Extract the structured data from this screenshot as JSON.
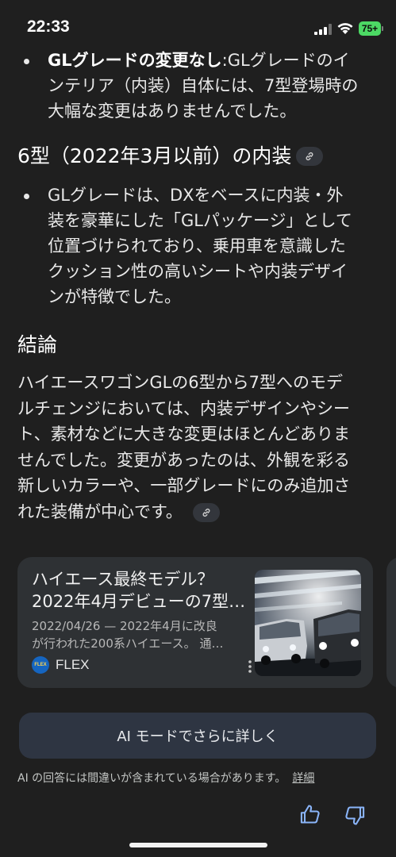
{
  "status_bar": {
    "time": "22:33",
    "battery": "75+",
    "battery_color": "#4cd964"
  },
  "content": {
    "bullet1": {
      "bold": "GLグレードの変更なし",
      "lines": [
        ":GLグレードのイ",
        "ンテリア（内装）自体には、7型登場時の",
        "大幅な変更はありませんでした。"
      ]
    },
    "heading1": "6型（2022年3月以前）の内装",
    "bullet2": {
      "lines": [
        "GLグレードは、DXをベースに内装・外",
        "装を豪華にした「GLパッケージ」として",
        "位置づけられており、乗用車を意識した",
        "クッション性の高いシートや内装デザイ",
        "ンが特徴でした。"
      ]
    },
    "heading2": "結論",
    "conclusion": {
      "lines": [
        "ハイエースワゴンGLの6型から7型へのモデ",
        "ルチェンジにおいては、内装デザインやシー",
        "ト、素材などに大きな変更はほとんどありま",
        "せんでした。変更があったのは、外観を彩る",
        "新しいカラーや、一部グレードにのみ追加さ",
        "れた装備が中心です。"
      ]
    }
  },
  "source_card": {
    "title_lines": [
      "ハイエース最終モデル？",
      "2022年4月デビューの7型…"
    ],
    "snippet_lines": [
      "2022/04/26 — 2022年4月に改良",
      "が行われた200系ハイエース。 通…"
    ],
    "logo_text": "FLEX",
    "source_name": "FLEX"
  },
  "ai_mode_button": "AI モードでさらに詳しく",
  "disclaimer": {
    "text": "AI の回答には間違いが含まれている場合があります。",
    "more": "詳細"
  },
  "icons": {
    "link": "link-icon",
    "thumb_up": "thumb-up-icon",
    "thumb_down": "thumb-down-icon",
    "more_vert": "more-vert-icon"
  },
  "colors": {
    "background": "#1f1f1f",
    "card": "#2e3134",
    "button": "#2e3542",
    "feedback_icon": "#8ab4f8"
  }
}
